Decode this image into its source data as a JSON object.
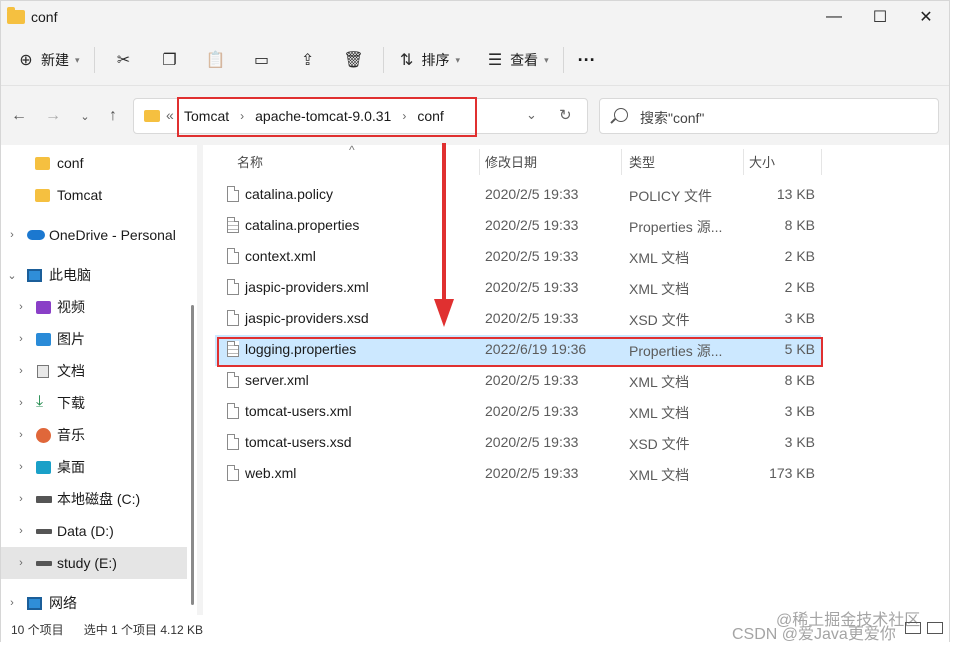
{
  "window": {
    "title": "conf"
  },
  "titlebar": {
    "minimize": "—",
    "maximize": "☐",
    "close": "✕"
  },
  "toolbar": {
    "new_label": "新建",
    "sort_label": "排序",
    "view_label": "查看",
    "more_label": "···"
  },
  "address": {
    "crumbs": [
      "Tomcat",
      "apache-tomcat-9.0.31",
      "conf"
    ],
    "overflow": "«",
    "search_placeholder": "搜索\"conf\""
  },
  "sidebar": {
    "items": [
      {
        "label": "conf",
        "icon": "folder-icon"
      },
      {
        "label": "Tomcat",
        "icon": "folder-icon"
      },
      {
        "label": "OneDrive - Personal",
        "icon": "cloud-icon"
      },
      {
        "label": "此电脑",
        "icon": "computer-icon"
      },
      {
        "label": "视频",
        "icon": "video-icon"
      },
      {
        "label": "图片",
        "icon": "image-icon"
      },
      {
        "label": "文档",
        "icon": "document-icon"
      },
      {
        "label": "下载",
        "icon": "download-icon"
      },
      {
        "label": "音乐",
        "icon": "music-icon"
      },
      {
        "label": "桌面",
        "icon": "desktop-icon"
      },
      {
        "label": "本地磁盘 (C:)",
        "icon": "drive-icon"
      },
      {
        "label": "Data (D:)",
        "icon": "drive-icon"
      },
      {
        "label": "study (E:)",
        "icon": "drive-icon"
      },
      {
        "label": "网络",
        "icon": "network-icon"
      }
    ]
  },
  "columns": {
    "name": "名称",
    "modified": "修改日期",
    "type": "类型",
    "size": "大小"
  },
  "files": [
    {
      "name": "catalina.policy",
      "modified": "2020/2/5 19:33",
      "type": "POLICY 文件",
      "size": "13 KB"
    },
    {
      "name": "catalina.properties",
      "modified": "2020/2/5 19:33",
      "type": "Properties 源...",
      "size": "8 KB"
    },
    {
      "name": "context.xml",
      "modified": "2020/2/5 19:33",
      "type": "XML 文档",
      "size": "2 KB"
    },
    {
      "name": "jaspic-providers.xml",
      "modified": "2020/2/5 19:33",
      "type": "XML 文档",
      "size": "2 KB"
    },
    {
      "name": "jaspic-providers.xsd",
      "modified": "2020/2/5 19:33",
      "type": "XSD 文件",
      "size": "3 KB"
    },
    {
      "name": "logging.properties",
      "modified": "2022/6/19 19:36",
      "type": "Properties 源...",
      "size": "5 KB"
    },
    {
      "name": "server.xml",
      "modified": "2020/2/5 19:33",
      "type": "XML 文档",
      "size": "8 KB"
    },
    {
      "name": "tomcat-users.xml",
      "modified": "2020/2/5 19:33",
      "type": "XML 文档",
      "size": "3 KB"
    },
    {
      "name": "tomcat-users.xsd",
      "modified": "2020/2/5 19:33",
      "type": "XSD 文件",
      "size": "3 KB"
    },
    {
      "name": "web.xml",
      "modified": "2020/2/5 19:33",
      "type": "XML 文档",
      "size": "173 KB"
    }
  ],
  "status": {
    "count": "10 个项目",
    "selection": "选中 1 个项目  4.12 KB"
  },
  "watermark": {
    "line1": "@稀土掘金技术社区",
    "line2": "CSDN @爱Java更爱你"
  },
  "colors": {
    "selection": "#cce8ff",
    "annotation": "#e03030",
    "folder": "#f5c040"
  }
}
